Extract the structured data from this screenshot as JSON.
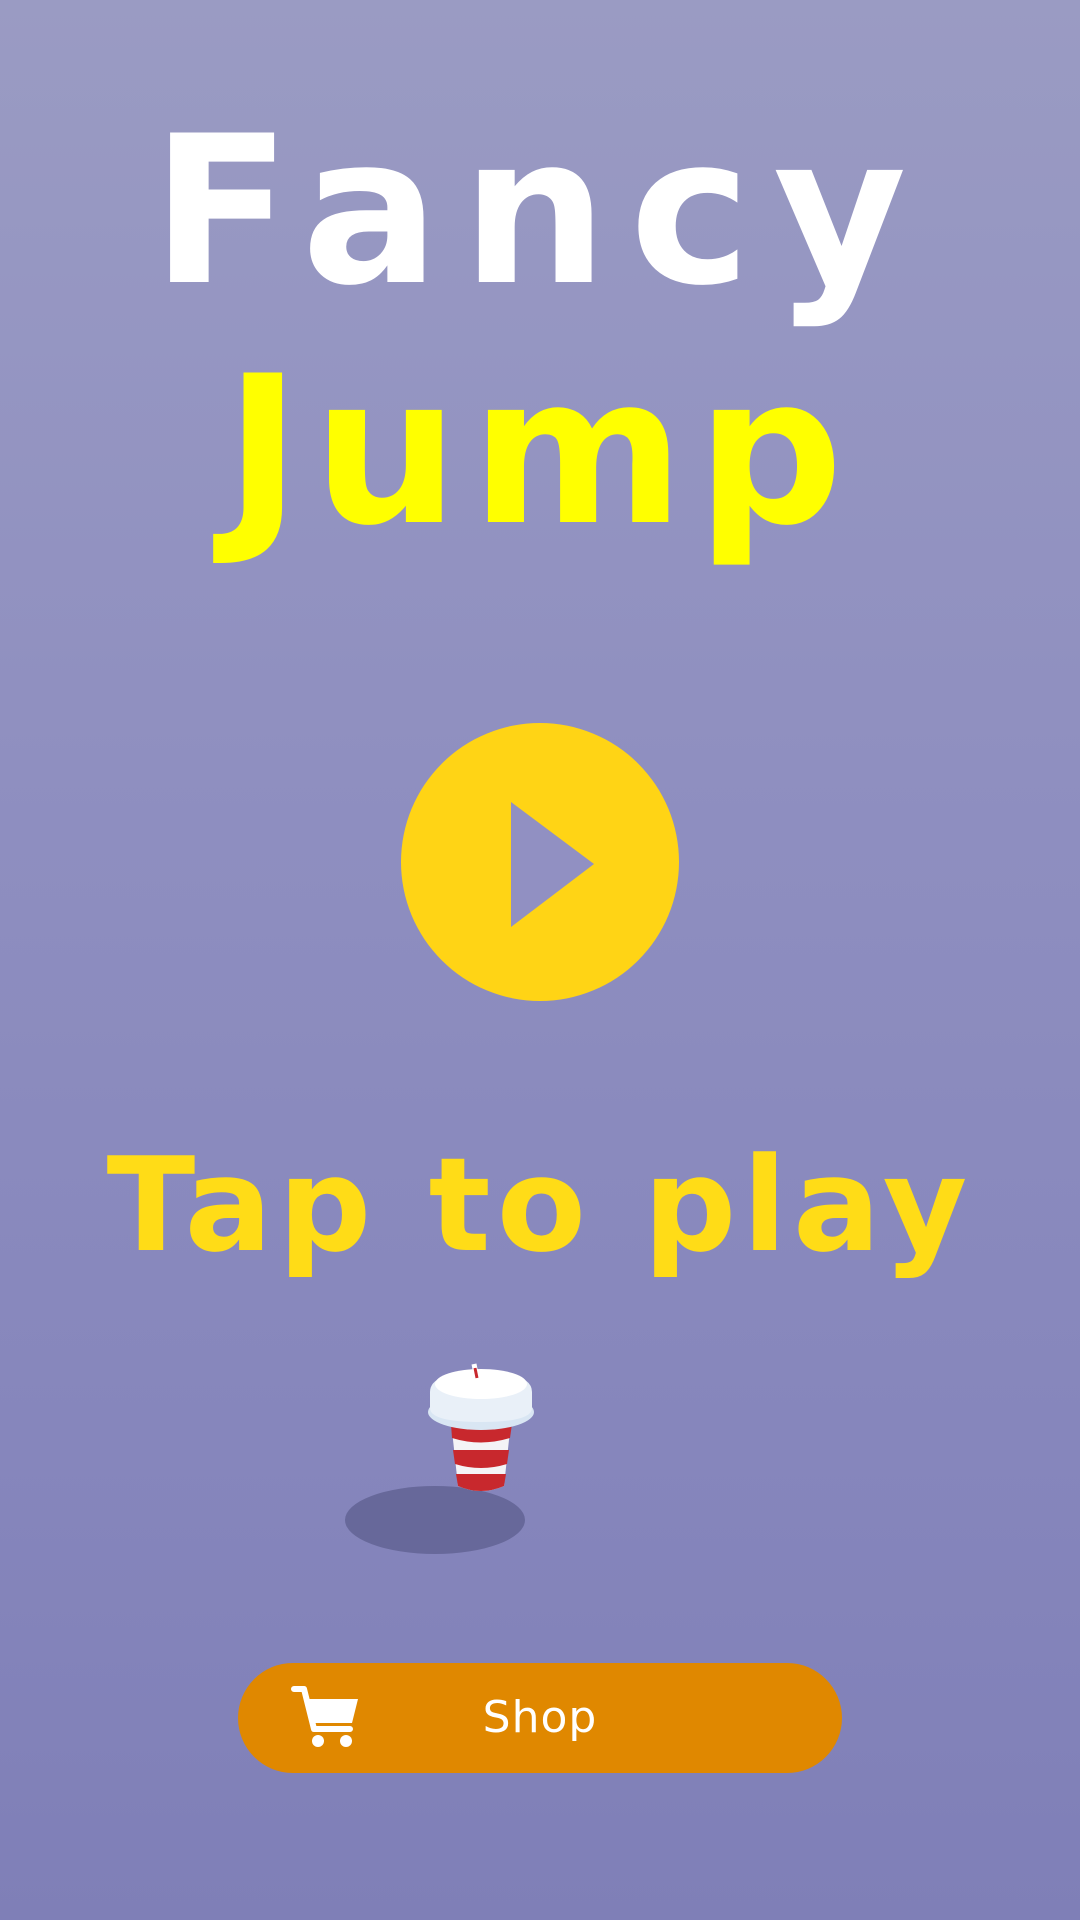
{
  "title": {
    "line1": "Fancy",
    "line2": "Jump"
  },
  "prompt": "Tap to play",
  "shop": {
    "label": "Shop",
    "icon": "cart-icon"
  },
  "play": {
    "icon": "play-icon"
  },
  "character": {
    "icon": "striped-cup-icon"
  },
  "colors": {
    "background": "#8f8fc0",
    "title_white": "#ffffff",
    "title_yellow": "#ffff00",
    "play_button": "#ffd415",
    "prompt_yellow": "#ffdc17",
    "shop_button": "#e08800",
    "cup_red": "#c8282d"
  }
}
